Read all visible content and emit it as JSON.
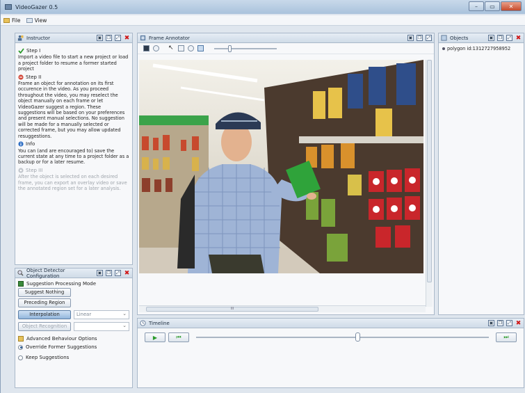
{
  "window": {
    "title": "VideoGazer  0.5"
  },
  "menu": {
    "items": [
      {
        "label": "File",
        "icon": "folder-icon"
      },
      {
        "label": "View",
        "icon": "view-icon"
      }
    ]
  },
  "instructor": {
    "title": "Instructor",
    "steps": [
      {
        "title": "Step I",
        "icon": "check-icon",
        "text": "Import a video file to start a new project or load a project folder to resume a former started project",
        "muted": false
      },
      {
        "title": "Step II",
        "icon": "error-icon",
        "text": "Frame an object for annotation on its first occurence in the video. As you proceed throughout the video, you may reselect the object manually on each frame or let VideoGazer suggest a region. These suggestions will be based on your preferences and present manual selections. No suggestion will be made for a manually selected or corrected frame, but you may allow updated resuggestions.",
        "muted": false
      },
      {
        "title": "Info",
        "icon": "info-icon",
        "text": "You can (and are encouraged to) save the current state at any time to a project folder as a backup or for a later resume.",
        "muted": false
      },
      {
        "title": "Step III",
        "icon": "gear-icon",
        "text": "After the object is selected on each desired frame, you can export an overlay video or save the annotated region set for a later analysis.",
        "muted": true
      }
    ]
  },
  "detector": {
    "title": "Object Detector Configuration",
    "section1": "Suggestion Processing Mode",
    "btn_suggest_nothing": "Suggest Nothing",
    "btn_preceding": "Preceding Region",
    "btn_interpolation": "Interpolation",
    "interp_option": "Linear",
    "btn_object_recognition": "Object Recognition",
    "recog_option": "",
    "section2": "Advanced Behaviour Options",
    "radio_override": "Override Former Suggestions",
    "radio_keep": "Keep Suggestions"
  },
  "annotator": {
    "title": "Frame Annotator",
    "hscroll_label": "III"
  },
  "objects": {
    "title": "Objects",
    "items": [
      "polygon id:1312727958952"
    ]
  },
  "timeline": {
    "title": "Timeline",
    "position": 0.55
  }
}
